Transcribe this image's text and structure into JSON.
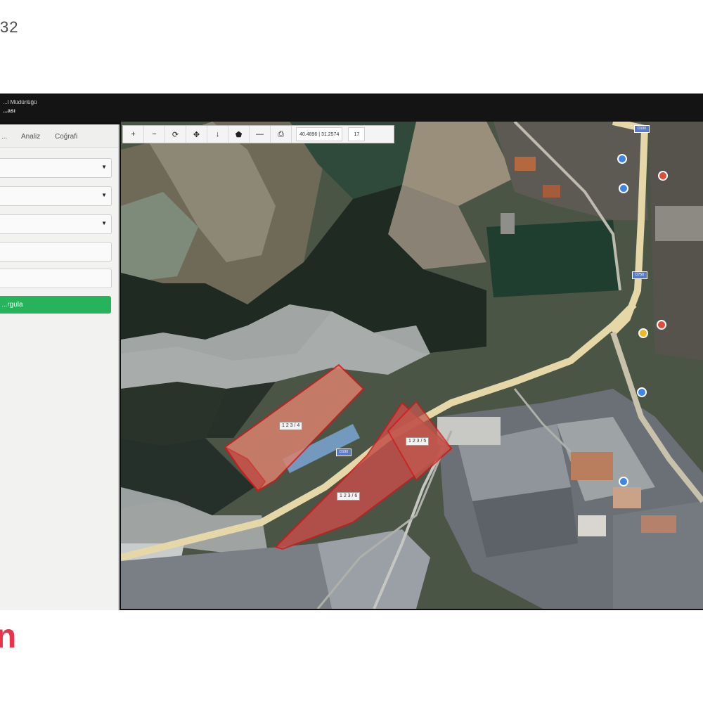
{
  "corner_number": "32",
  "brand_mark": "n",
  "title_bar": {
    "line1": "...l Müdürlüğü",
    "line2": "...ası"
  },
  "sidebar": {
    "tabs": [
      "...",
      "Analiz",
      "Coğrafi"
    ],
    "fields": [
      {
        "type": "select",
        "value": ""
      },
      {
        "type": "select",
        "value": ""
      },
      {
        "type": "select",
        "value": ""
      },
      {
        "type": "input",
        "value": ""
      },
      {
        "type": "input",
        "value": ""
      }
    ],
    "action_button": "...rgula"
  },
  "map": {
    "toolbar_icons": [
      "zoom-in-icon",
      "zoom-out-icon",
      "refresh-icon",
      "pan-icon",
      "locate-icon",
      "polygon-icon",
      "measure-icon",
      "print-icon"
    ],
    "toolbar_glyphs": [
      "+",
      "−",
      "⟳",
      "✥",
      "↓",
      "⬟",
      "—",
      "⎙"
    ],
    "coord_x": "40.4896",
    "coord_y": "31.2574",
    "zoom": "17",
    "parcel_labels": [
      "1 2 3 / 4",
      "1 2 3 / 5",
      "1 2 3 / 6"
    ],
    "road_labels": [
      "D100",
      "D100",
      "D750"
    ],
    "colors": {
      "parcel_fill": "#d9826e",
      "parcel_stroke": "#d11a1a",
      "road": "#e9dcae",
      "green_button": "#27b35a"
    }
  }
}
